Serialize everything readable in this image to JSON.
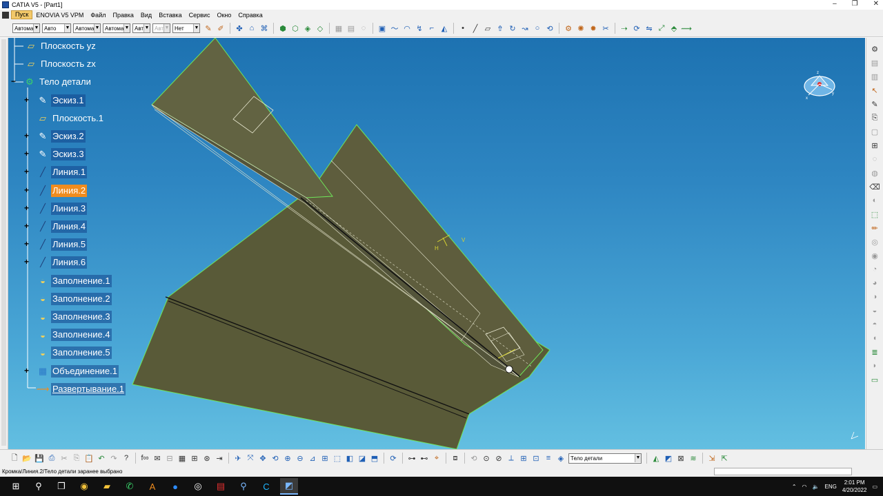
{
  "window": {
    "title": "CATIA V5 - [Part1]",
    "controls": [
      "–",
      "❐",
      "✕"
    ]
  },
  "menu": {
    "items": [
      "Пуск",
      "ENOVIA V5 VPM",
      "Файл",
      "Правка",
      "Вид",
      "Вставка",
      "Сервис",
      "Окно",
      "Справка"
    ]
  },
  "toolbar": {
    "selects": [
      {
        "value": "Автома",
        "width": 40
      },
      {
        "value": "Авто",
        "width": 42
      },
      {
        "value": "Автома",
        "width": 40
      },
      {
        "value": "Автома",
        "width": 40
      },
      {
        "value": "Авт",
        "width": 26
      },
      {
        "value": "Авт",
        "width": 26,
        "disabled": true
      },
      {
        "value": "Нет",
        "width": 40
      }
    ]
  },
  "tree": {
    "items": [
      {
        "label": "Плоскость yz",
        "icon": "plane-icon",
        "style": ""
      },
      {
        "label": "Плоскость zx",
        "icon": "plane-icon",
        "style": ""
      },
      {
        "label": "Тело детали",
        "icon": "part-body-icon",
        "style": ""
      },
      {
        "label": "Эскиз.1",
        "icon": "sketch-icon",
        "style": "boxed"
      },
      {
        "label": "Плоскость.1",
        "icon": "plane-icon",
        "style": ""
      },
      {
        "label": "Эскиз.2",
        "icon": "sketch-icon",
        "style": "boxed"
      },
      {
        "label": "Эскиз.3",
        "icon": "sketch-icon",
        "style": "boxed"
      },
      {
        "label": "Линия.1",
        "icon": "line-icon",
        "style": "boxed"
      },
      {
        "label": "Линия.2",
        "icon": "line-icon",
        "style": "sel-orange"
      },
      {
        "label": "Линия.3",
        "icon": "line-icon",
        "style": "boxed"
      },
      {
        "label": "Линия.4",
        "icon": "line-icon",
        "style": "boxed"
      },
      {
        "label": "Линия.5",
        "icon": "line-icon",
        "style": "boxed"
      },
      {
        "label": "Линия.6",
        "icon": "line-icon",
        "style": "boxed"
      },
      {
        "label": "Заполнение.1",
        "icon": "fill-icon",
        "style": "boxed"
      },
      {
        "label": "Заполнение.2",
        "icon": "fill-icon",
        "style": "boxed"
      },
      {
        "label": "Заполнение.3",
        "icon": "fill-icon",
        "style": "boxed"
      },
      {
        "label": "Заполнение.4",
        "icon": "fill-icon",
        "style": "boxed"
      },
      {
        "label": "Заполнение.5",
        "icon": "fill-icon",
        "style": "boxed"
      },
      {
        "label": "Объединение.1",
        "icon": "join-icon",
        "style": "boxed"
      },
      {
        "label": "Развертывание.1",
        "icon": "unfold-icon",
        "style": "underl"
      }
    ]
  },
  "bottom": {
    "current_body": "Тело детали"
  },
  "status": {
    "message": "Кромка/Линия.2/Тело детали заранее выбрано"
  },
  "taskbar": {
    "lang": "ENG",
    "time": "2:01 PM",
    "date": "4/20/2022"
  },
  "viewport": {
    "axis_labels": {
      "h": "H",
      "v": "V"
    },
    "compass_axes": {
      "x": "x",
      "y": "y",
      "z": "z"
    }
  },
  "colors": {
    "surface": "#5b5b3c",
    "edge": "#6fe65a",
    "selection": "#f08c1e",
    "background_top": "#1d72b1",
    "background_bottom": "#63bfe1"
  }
}
